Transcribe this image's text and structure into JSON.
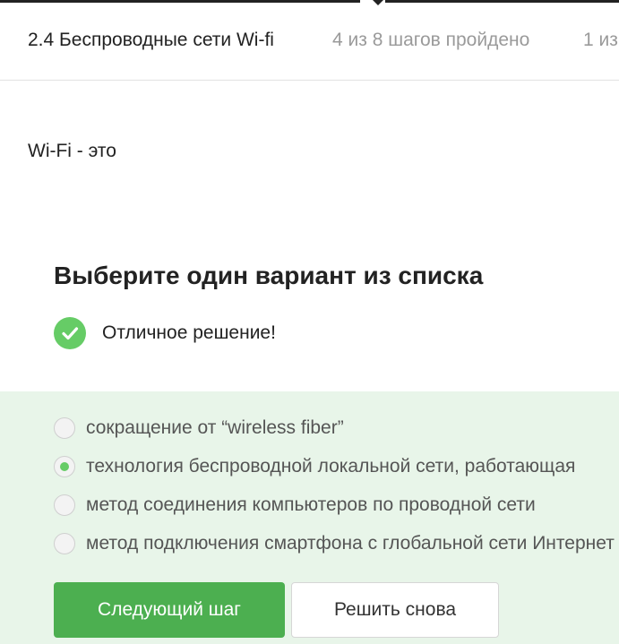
{
  "header": {
    "lesson_title": "2.4 Беспроводные сети Wi-fi",
    "progress": "4 из 8 шагов пройдено",
    "points": "1 из"
  },
  "question": {
    "text": "Wi-Fi - это"
  },
  "quiz": {
    "title": "Выберите один вариант из списка",
    "feedback": "Отличное решение!",
    "feedback_icon": "checkmark-circle-icon",
    "options": [
      {
        "label": "сокращение от “wireless fiber”",
        "selected": false
      },
      {
        "label": "технология беспроводной локальной сети, работающая",
        "selected": true
      },
      {
        "label": "метод соединения компьютеров по проводной сети",
        "selected": false
      },
      {
        "label": "метод подключения смартфона с глобальной сети Интернет",
        "selected": false
      }
    ],
    "next_button": "Следующий шаг",
    "retry_button": "Решить снова"
  },
  "colors": {
    "accent_green": "#4caf50",
    "success_icon": "#66cc66",
    "options_background": "#e8f5e9"
  }
}
